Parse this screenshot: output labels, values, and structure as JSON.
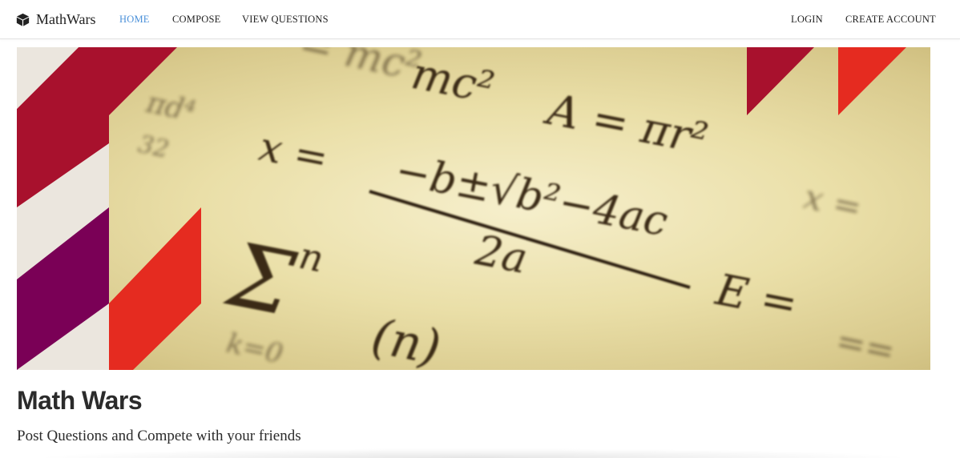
{
  "navbar": {
    "brand": "MathWars",
    "brand_icon": "cube-icon",
    "links": {
      "home": "HOME",
      "compose": "COMPOSE",
      "view_questions": "VIEW QUESTIONS",
      "login": "LOGIN",
      "create_account": "CREATE ACCOUNT"
    },
    "active": "home",
    "active_color": "#4a90d9"
  },
  "hero": {
    "colors": {
      "crimson": "#a8112d",
      "purple": "#7a0056",
      "red": "#e52b20",
      "cream": "#ebe6de"
    }
  },
  "main": {
    "title": "Math Wars",
    "subtitle": "Post Questions and Compete with your friends"
  }
}
